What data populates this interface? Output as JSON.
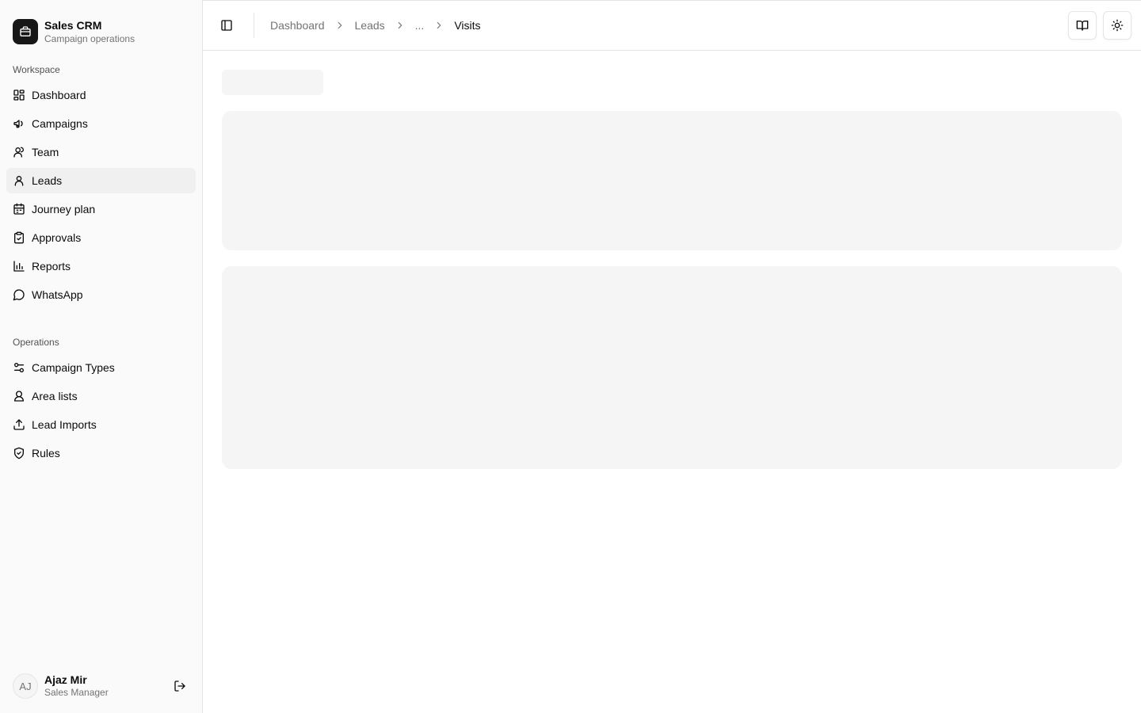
{
  "brand": {
    "title": "Sales CRM",
    "subtitle": "Campaign operations",
    "icon": "briefcase-icon"
  },
  "sidebar": {
    "groups": [
      {
        "label": "Workspace",
        "items": [
          {
            "label": "Dashboard",
            "icon": "dashboard-icon"
          },
          {
            "label": "Campaigns",
            "icon": "megaphone-icon"
          },
          {
            "label": "Team",
            "icon": "users-icon"
          },
          {
            "label": "Leads",
            "icon": "user-icon",
            "active": true
          },
          {
            "label": "Journey plan",
            "icon": "calendar-icon"
          },
          {
            "label": "Approvals",
            "icon": "clipboard-check-icon"
          },
          {
            "label": "Reports",
            "icon": "bar-chart-icon"
          },
          {
            "label": "WhatsApp",
            "icon": "message-circle-icon"
          }
        ]
      },
      {
        "label": "Operations",
        "items": [
          {
            "label": "Campaign Types",
            "icon": "sliders-icon"
          },
          {
            "label": "Area lists",
            "icon": "map-user-icon"
          },
          {
            "label": "Lead Imports",
            "icon": "upload-icon"
          },
          {
            "label": "Rules",
            "icon": "shield-check-icon"
          }
        ]
      }
    ]
  },
  "user": {
    "initials": "AJ",
    "name": "Ajaz Mir",
    "role": "Sales Manager"
  },
  "breadcrumb": [
    "Dashboard",
    "Leads",
    "...",
    "Visits"
  ],
  "colors": {
    "sidebar_bg": "#fafafa",
    "active_item_bg": "#f0f0f0",
    "skeleton": "#f5f5f5",
    "border": "#e5e5e5",
    "muted_text": "#737373"
  }
}
